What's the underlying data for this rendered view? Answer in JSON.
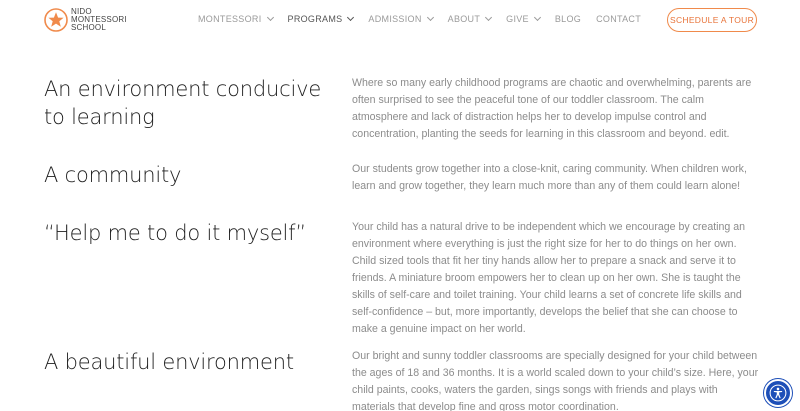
{
  "brand": {
    "line1": "NIDO",
    "line2": "MONTESSORI",
    "line3": "SCHOOL",
    "accent_color": "#f08a4b"
  },
  "nav": {
    "items": [
      {
        "label": "MONTESSORI",
        "has_dropdown": true,
        "active": false
      },
      {
        "label": "PROGRAMS",
        "has_dropdown": true,
        "active": true
      },
      {
        "label": "ADMISSION",
        "has_dropdown": true,
        "active": false
      },
      {
        "label": "ABOUT",
        "has_dropdown": true,
        "active": false
      },
      {
        "label": "GIVE",
        "has_dropdown": true,
        "active": false
      },
      {
        "label": "BLOG",
        "has_dropdown": false,
        "active": false
      },
      {
        "label": "CONTACT",
        "has_dropdown": false,
        "active": false
      }
    ],
    "cta_label": "SCHEDULE A TOUR"
  },
  "sections": [
    {
      "title": "An environment conducive to learning",
      "body": "Where so many early childhood programs are chaotic and overwhelming, parents are often surprised to see the peaceful tone of our toddler classroom. The calm atmosphere and lack of distraction helps her to develop impulse control and concentration, planting the seeds for learning in this classroom and beyond. edit."
    },
    {
      "title": "A community",
      "body": "Our students grow together into a close-knit, caring community. When children work, learn and grow together, they learn much more than any of them could learn alone!"
    },
    {
      "title": "“Help me to do it myself”",
      "body": "Your child has a natural drive to be independent which we encourage by creating an environment where everything is just the right size for her to do things on her own. Child sized tools that fit her tiny hands allow her to prepare a snack and serve it to friends. A miniature broom empowers her to clean up on her own. She is taught the skills of self-care and toilet training. Your child learns a set of concrete life skills and self-confidence – but, more importantly, develops the belief that she can choose to make a genuine impact on her world."
    },
    {
      "title": "A beautiful environment",
      "body": "Our bright and sunny toddler classrooms are specially designed for your child between the ages of 18 and 36 months. It is a world scaled down to your child’s size. Here, your child paints, cooks, waters the garden, sings songs with friends and plays with materials that develop fine and gross motor coordination."
    }
  ],
  "accessibility": {
    "icon": "accessibility-icon",
    "color": "#1d4fb8"
  }
}
